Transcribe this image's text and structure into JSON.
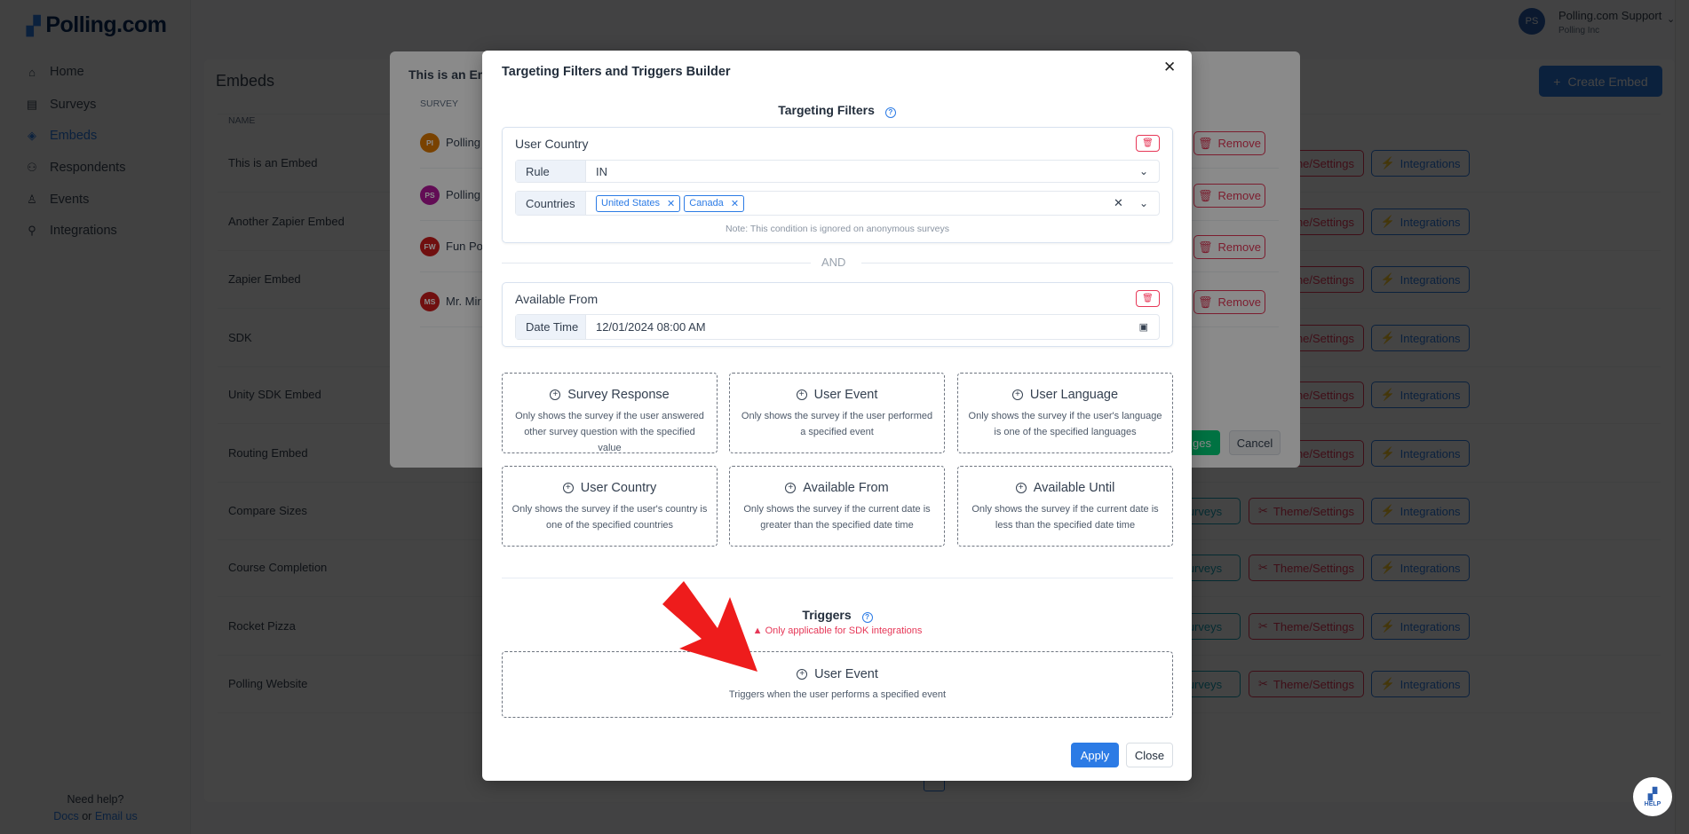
{
  "app": {
    "logo": "Polling.com",
    "user_name": "Polling.com Support",
    "user_org": "Polling Inc",
    "user_initials": "PS"
  },
  "sidebar": {
    "items": [
      {
        "label": "Home",
        "icon": "home-icon"
      },
      {
        "label": "Surveys",
        "icon": "surveys-icon"
      },
      {
        "label": "Embeds",
        "icon": "embeds-icon",
        "active": true
      },
      {
        "label": "Respondents",
        "icon": "respondents-icon"
      },
      {
        "label": "Events",
        "icon": "events-icon"
      },
      {
        "label": "Integrations",
        "icon": "integrations-icon"
      }
    ],
    "help": "Need help?",
    "docs": "Docs",
    "or": "or",
    "email": "Email us"
  },
  "page": {
    "title": "Embeds",
    "create_button": "Create Embed",
    "col_name": "NAME",
    "rows": [
      "This is an Embed",
      "Another Zapier Embed",
      "Zapier Embed",
      "SDK",
      "Unity SDK Embed",
      "Routing Embed",
      "Compare Sizes",
      "Course Completion",
      "Rocket Pizza",
      "Polling Website"
    ],
    "surveys_label": "Surveys",
    "theme_label": "Theme/Settings",
    "integrations_label": "Integrations"
  },
  "bg_modal": {
    "title": "This is an Em",
    "col_survey": "SURVEY",
    "remove_label": "Remove",
    "save_label": "ges",
    "cancel_label": "Cancel",
    "rows": [
      {
        "initials": "PI",
        "name": "Polling",
        "color": "#e07b00"
      },
      {
        "initials": "PS",
        "name": "Polling",
        "color": "#b5179e"
      },
      {
        "initials": "FW",
        "name": "Fun Pol",
        "color": "#d01c1c"
      },
      {
        "initials": "MS",
        "name": "Mr. Mir",
        "color": "#d01c1c"
      }
    ]
  },
  "modal": {
    "title": "Targeting Filters and Triggers Builder",
    "filters_heading": "Targeting Filters",
    "user_country": {
      "label": "User Country",
      "rule_label": "Rule",
      "rule_value": "IN",
      "countries_label": "Countries",
      "countries": [
        "United States",
        "Canada"
      ],
      "note": "Note: This condition is ignored on anonymous surveys"
    },
    "and_label": "AND",
    "available_from": {
      "label": "Available From",
      "datetime_label": "Date Time",
      "datetime_value": "12/01/2024 08:00 AM"
    },
    "options": [
      {
        "title": "Survey Response",
        "desc": "Only shows the survey if the user answered other survey question with the specified value"
      },
      {
        "title": "User Event",
        "desc": "Only shows the survey if the user performed a specified event"
      },
      {
        "title": "User Language",
        "desc": "Only shows the survey if the user's language is one of the specified languages"
      },
      {
        "title": "User Country",
        "desc": "Only shows the survey if the user's country is one of the specified countries"
      },
      {
        "title": "Available From",
        "desc": "Only shows the survey if the current date is greater than the specified date time"
      },
      {
        "title": "Available Until",
        "desc": "Only shows the survey if the current date is less than the specified date time"
      }
    ],
    "triggers_heading": "Triggers",
    "triggers_warning": "Only applicable for SDK integrations",
    "trigger": {
      "title": "User Event",
      "desc": "Triggers when the user performs a specified event"
    },
    "apply": "Apply",
    "close": "Close"
  },
  "help_widget": "HELP",
  "colors": {
    "primary": "#2c7be5",
    "danger": "#e63757",
    "info": "#17a2b8",
    "success": "#00d27a",
    "annotation_arrow": "#ee1c1c"
  }
}
